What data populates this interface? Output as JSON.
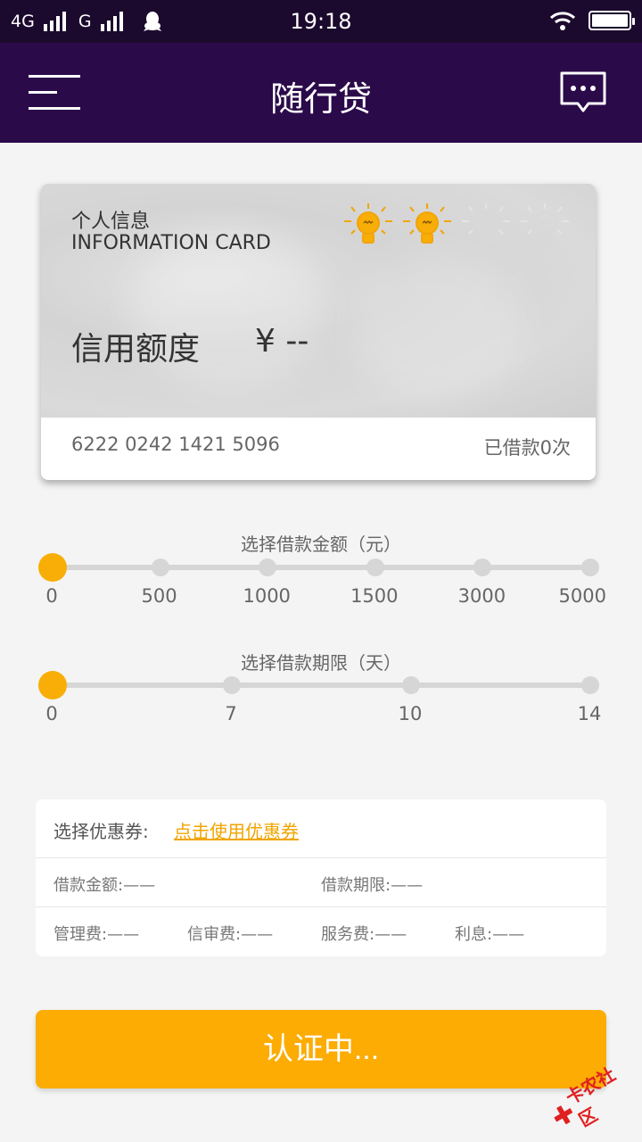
{
  "status_bar": {
    "network_left": "4G",
    "network_right": "G",
    "time": "19:18"
  },
  "header": {
    "title": "随行贷"
  },
  "card": {
    "title_cn": "个人信息",
    "title_en": "INFORMATION CARD",
    "credit_label": "信用额度",
    "credit_value": "¥ --",
    "card_number": "6222 0242 1421 5096",
    "loan_count": "已借款0次",
    "rating": {
      "lit": 2,
      "total": 4
    }
  },
  "amount_slider": {
    "title": "选择借款金额（元）",
    "ticks": [
      "0",
      "500",
      "1000",
      "1500",
      "3000",
      "5000"
    ],
    "selected": "0"
  },
  "term_slider": {
    "title": "选择借款期限（天）",
    "ticks": [
      "0",
      "7",
      "10",
      "14"
    ],
    "selected": "0"
  },
  "info": {
    "coupon_label": "选择优惠券:",
    "coupon_link": "点击使用优惠券",
    "amount": "借款金额:——",
    "term": "借款期限:——",
    "mgmt_fee": "管理费:——",
    "review_fee": "信审费:——",
    "service_fee": "服务费:——",
    "interest": "利息:——"
  },
  "submit_button": {
    "label": "认证中..."
  },
  "watermark": {
    "text": "卡农社区"
  },
  "colors": {
    "accent": "#fcac03",
    "header_bg": "#2b0a4a",
    "statusbar_bg": "#1c0a2e"
  }
}
